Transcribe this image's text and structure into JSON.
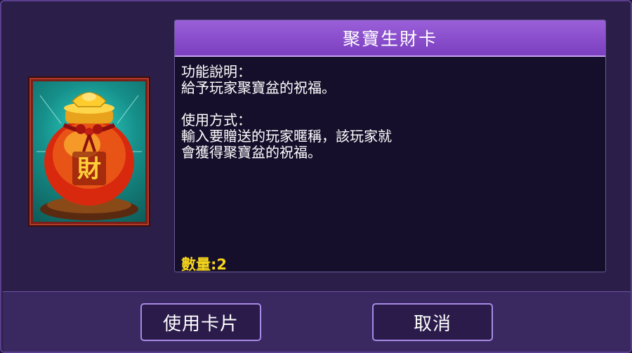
{
  "item": {
    "title": "聚寶生財卡",
    "function_heading": "功能說明：",
    "function_text": "給予玩家聚寶盆的祝福。",
    "usage_heading": "使用方式：",
    "usage_line1": "輸入要贈送的玩家暱稱，該玩家就",
    "usage_line2": "會獲得聚寶盆的祝福。",
    "quantity_label": "數量:2",
    "image_icon": "treasure-pot-icon"
  },
  "buttons": {
    "use_label": "使用卡片",
    "cancel_label": "取消"
  },
  "colors": {
    "header": "#8b4fcf",
    "quantity": "#f5d61a",
    "button_border": "#a78ae6"
  }
}
